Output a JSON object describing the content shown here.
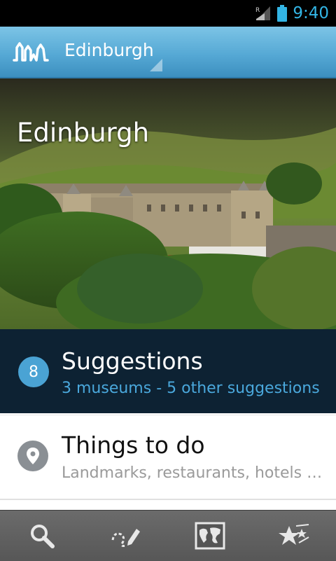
{
  "status_bar": {
    "time": "9:40",
    "signal_icon": "signal-roaming-icon",
    "battery_icon": "battery-icon",
    "accent": "#33b5e5"
  },
  "action_bar": {
    "logo_icon": "city-skyline-logo-icon",
    "title": "Edinburgh",
    "background": "#56a9d5"
  },
  "hero": {
    "title": "Edinburgh"
  },
  "suggestions": {
    "count": "8",
    "title": "Suggestions",
    "subtitle": "3 museums - 5 other suggestions"
  },
  "things_to_do": {
    "icon": "location-pin-icon",
    "title": "Things to do",
    "subtitle": "Landmarks, restaurants, hotels …"
  },
  "bottom_bar": {
    "items": [
      {
        "icon": "search-icon"
      },
      {
        "icon": "draw-route-icon"
      },
      {
        "icon": "world-map-icon"
      },
      {
        "icon": "favorites-stars-icon"
      }
    ]
  }
}
